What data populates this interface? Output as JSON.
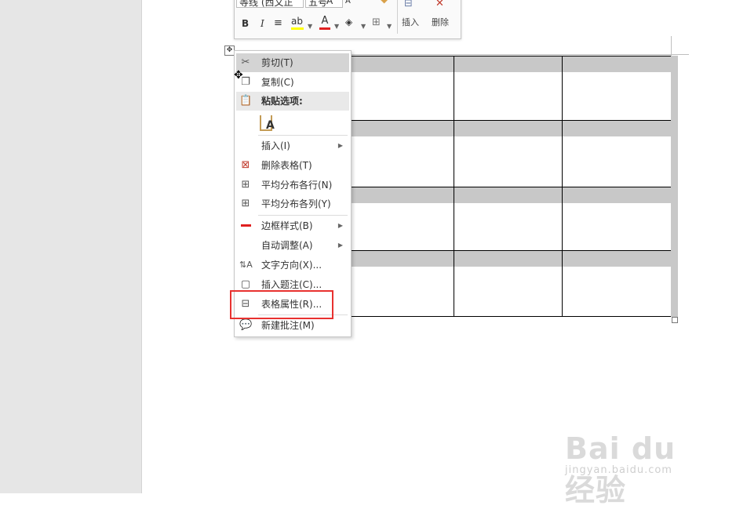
{
  "mini_toolbar": {
    "font_name": "等线 (西文正",
    "font_size": "五号",
    "grow_font": "A",
    "shrink_font": "A",
    "bold": "B",
    "italic": "I",
    "insert_label": "插入",
    "delete_label": "删除"
  },
  "table_handle": "✥",
  "context_menu": {
    "items": [
      {
        "label": "剪切(T)",
        "icon": "scissors-icon"
      },
      {
        "label": "复制(C)",
        "icon": "copy-icon"
      },
      {
        "label": "粘贴选项:",
        "icon": "paste-icon"
      },
      {
        "label": "A",
        "icon": "paste-text-only-icon"
      },
      {
        "label": "插入(I)",
        "icon": ""
      },
      {
        "label": "删除表格(T)",
        "icon": "delete-table-icon"
      },
      {
        "label": "平均分布各行(N)",
        "icon": "distribute-rows-icon"
      },
      {
        "label": "平均分布各列(Y)",
        "icon": "distribute-columns-icon"
      },
      {
        "label": "边框样式(B)",
        "icon": "border-style-icon"
      },
      {
        "label": "自动调整(A)",
        "icon": ""
      },
      {
        "label": "文字方向(X)...",
        "icon": "text-direction-icon"
      },
      {
        "label": "插入题注(C)...",
        "icon": "insert-caption-icon"
      },
      {
        "label": "表格属性(R)...",
        "icon": "table-properties-icon"
      },
      {
        "label": "新建批注(M)",
        "icon": "new-comment-icon"
      }
    ]
  },
  "colors": {
    "highlight_outline": "#e8312f",
    "shading": "#c8c8c8",
    "highlight_color": "#ffff00",
    "font_color": "#e02020"
  },
  "watermark": {
    "logo": "Bai du 经验",
    "url": "jingyan.baidu.com"
  }
}
